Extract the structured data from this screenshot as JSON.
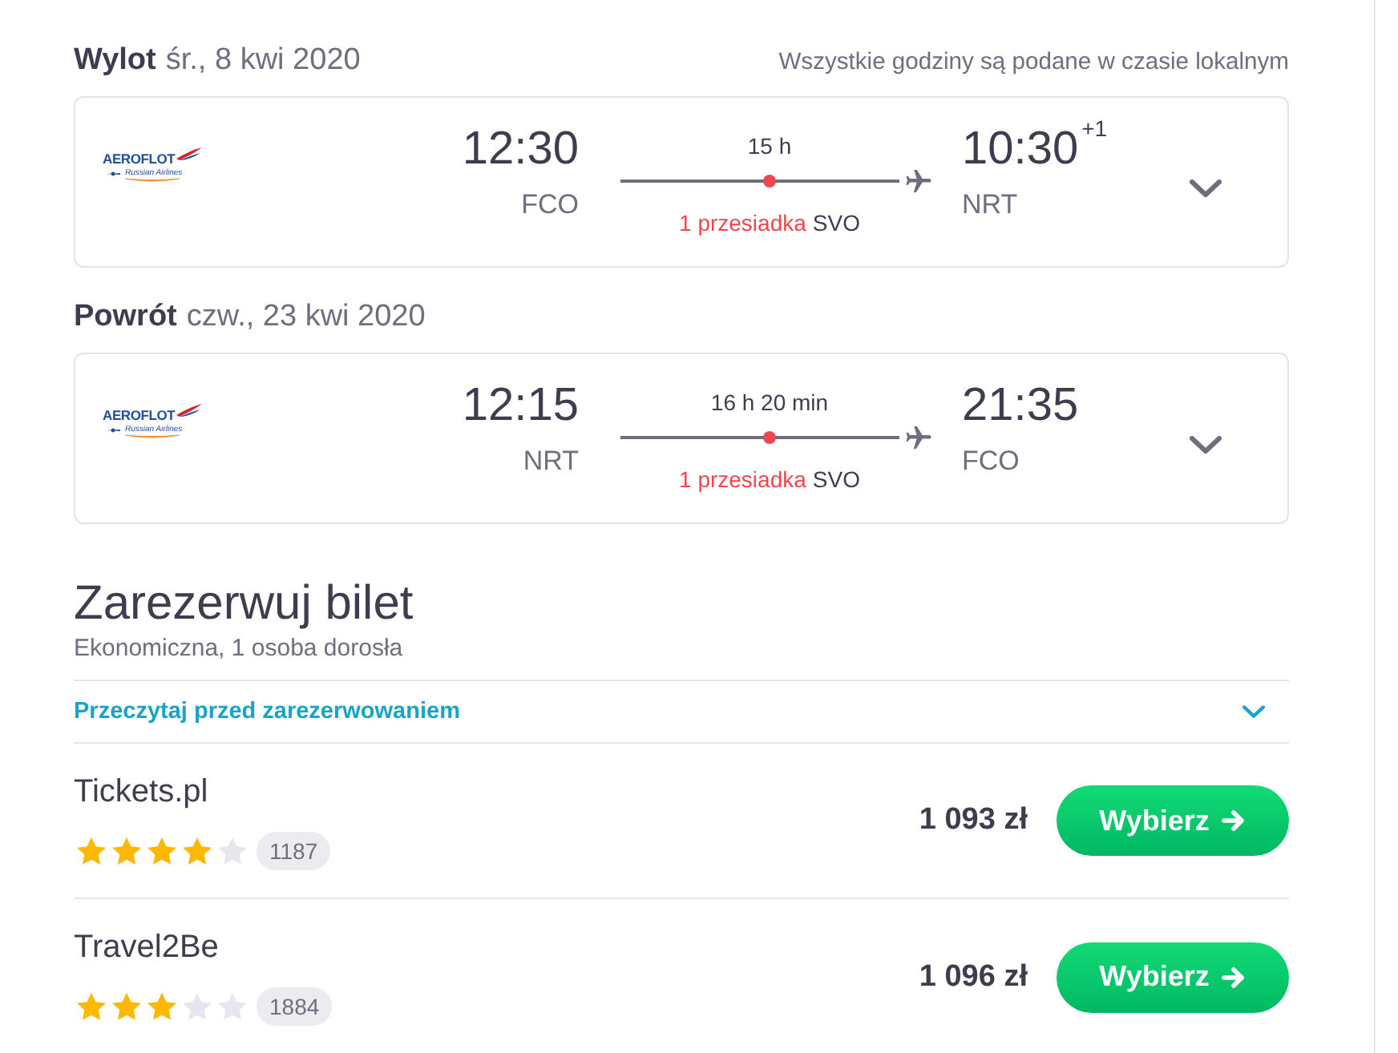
{
  "flights": [
    {
      "direction": "Wylot",
      "date": "śr., 8 kwi 2020",
      "note": "Wszystkie godziny są podane w czasie lokalnym",
      "airline": {
        "wordmark": "AEROFLOT",
        "tagline": "Russian Airlines"
      },
      "departure": {
        "time": "12:30",
        "airport": "FCO"
      },
      "duration": "15 h",
      "stops": "1 przesiadka",
      "stop_airport": "SVO",
      "arrival": {
        "time": "10:30",
        "day_offset": "+1",
        "airport": "NRT"
      },
      "expanded": false
    },
    {
      "direction": "Powrót",
      "date": "czw., 23 kwi 2020",
      "airline": {
        "wordmark": "AEROFLOT",
        "tagline": "Russian Airlines"
      },
      "departure": {
        "time": "12:15",
        "airport": "NRT"
      },
      "duration": "16 h 20 min",
      "stops": "1 przesiadka",
      "stop_airport": "SVO",
      "arrival": {
        "time": "21:35",
        "airport": "FCO"
      },
      "expanded": false
    }
  ],
  "booking": {
    "title": "Zarezerwuj bilet",
    "subtitle": "Ekonomiczna, 1 osoba dorosła",
    "notice": {
      "label": "Przeczytaj przed zarezerwowaniem",
      "expanded": false
    }
  },
  "offers": [
    {
      "provider": "Tickets.pl",
      "stars": 4,
      "reviews": "1187",
      "price": "1 093 zł",
      "button": "Wybierz"
    },
    {
      "provider": "Travel2Be",
      "stars": 3,
      "reviews": "1884",
      "price": "1 096 zł",
      "button": "Wybierz"
    }
  ]
}
